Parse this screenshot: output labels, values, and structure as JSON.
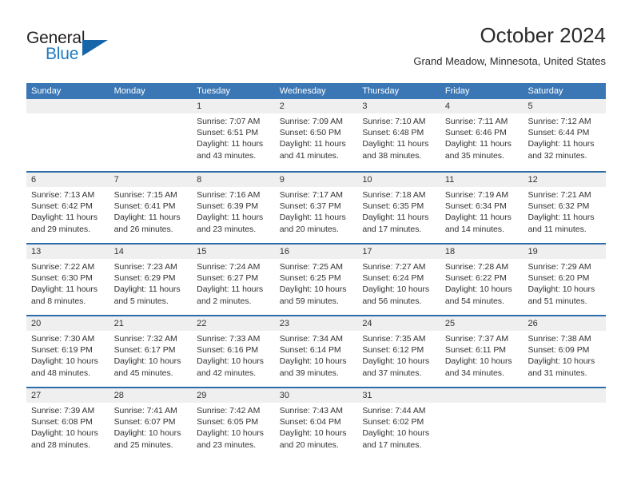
{
  "brand": {
    "name_top": "General",
    "name_bottom": "Blue",
    "triangle_icon": "triangle-icon",
    "color_top": "#231f20",
    "color_bottom": "#1f7bc1",
    "color_triangle": "#1565a8"
  },
  "header": {
    "month_title": "October 2024",
    "location": "Grand Meadow, Minnesota, United States"
  },
  "theme": {
    "header_blue": "#3b77b5",
    "row_divider_blue": "#2e6ca8",
    "date_band_gray": "#efefef",
    "text": "#333333"
  },
  "weekdays": [
    "Sunday",
    "Monday",
    "Tuesday",
    "Wednesday",
    "Thursday",
    "Friday",
    "Saturday"
  ],
  "weeks": [
    [
      {
        "day": "",
        "sunrise": "",
        "sunset": "",
        "daylight_line1": "",
        "daylight_line2": "",
        "empty": true
      },
      {
        "day": "",
        "sunrise": "",
        "sunset": "",
        "daylight_line1": "",
        "daylight_line2": "",
        "empty": true
      },
      {
        "day": "1",
        "sunrise": "Sunrise: 7:07 AM",
        "sunset": "Sunset: 6:51 PM",
        "daylight_line1": "Daylight: 11 hours",
        "daylight_line2": "and 43 minutes."
      },
      {
        "day": "2",
        "sunrise": "Sunrise: 7:09 AM",
        "sunset": "Sunset: 6:50 PM",
        "daylight_line1": "Daylight: 11 hours",
        "daylight_line2": "and 41 minutes."
      },
      {
        "day": "3",
        "sunrise": "Sunrise: 7:10 AM",
        "sunset": "Sunset: 6:48 PM",
        "daylight_line1": "Daylight: 11 hours",
        "daylight_line2": "and 38 minutes."
      },
      {
        "day": "4",
        "sunrise": "Sunrise: 7:11 AM",
        "sunset": "Sunset: 6:46 PM",
        "daylight_line1": "Daylight: 11 hours",
        "daylight_line2": "and 35 minutes."
      },
      {
        "day": "5",
        "sunrise": "Sunrise: 7:12 AM",
        "sunset": "Sunset: 6:44 PM",
        "daylight_line1": "Daylight: 11 hours",
        "daylight_line2": "and 32 minutes."
      }
    ],
    [
      {
        "day": "6",
        "sunrise": "Sunrise: 7:13 AM",
        "sunset": "Sunset: 6:42 PM",
        "daylight_line1": "Daylight: 11 hours",
        "daylight_line2": "and 29 minutes."
      },
      {
        "day": "7",
        "sunrise": "Sunrise: 7:15 AM",
        "sunset": "Sunset: 6:41 PM",
        "daylight_line1": "Daylight: 11 hours",
        "daylight_line2": "and 26 minutes."
      },
      {
        "day": "8",
        "sunrise": "Sunrise: 7:16 AM",
        "sunset": "Sunset: 6:39 PM",
        "daylight_line1": "Daylight: 11 hours",
        "daylight_line2": "and 23 minutes."
      },
      {
        "day": "9",
        "sunrise": "Sunrise: 7:17 AM",
        "sunset": "Sunset: 6:37 PM",
        "daylight_line1": "Daylight: 11 hours",
        "daylight_line2": "and 20 minutes."
      },
      {
        "day": "10",
        "sunrise": "Sunrise: 7:18 AM",
        "sunset": "Sunset: 6:35 PM",
        "daylight_line1": "Daylight: 11 hours",
        "daylight_line2": "and 17 minutes."
      },
      {
        "day": "11",
        "sunrise": "Sunrise: 7:19 AM",
        "sunset": "Sunset: 6:34 PM",
        "daylight_line1": "Daylight: 11 hours",
        "daylight_line2": "and 14 minutes."
      },
      {
        "day": "12",
        "sunrise": "Sunrise: 7:21 AM",
        "sunset": "Sunset: 6:32 PM",
        "daylight_line1": "Daylight: 11 hours",
        "daylight_line2": "and 11 minutes."
      }
    ],
    [
      {
        "day": "13",
        "sunrise": "Sunrise: 7:22 AM",
        "sunset": "Sunset: 6:30 PM",
        "daylight_line1": "Daylight: 11 hours",
        "daylight_line2": "and 8 minutes."
      },
      {
        "day": "14",
        "sunrise": "Sunrise: 7:23 AM",
        "sunset": "Sunset: 6:29 PM",
        "daylight_line1": "Daylight: 11 hours",
        "daylight_line2": "and 5 minutes."
      },
      {
        "day": "15",
        "sunrise": "Sunrise: 7:24 AM",
        "sunset": "Sunset: 6:27 PM",
        "daylight_line1": "Daylight: 11 hours",
        "daylight_line2": "and 2 minutes."
      },
      {
        "day": "16",
        "sunrise": "Sunrise: 7:25 AM",
        "sunset": "Sunset: 6:25 PM",
        "daylight_line1": "Daylight: 10 hours",
        "daylight_line2": "and 59 minutes."
      },
      {
        "day": "17",
        "sunrise": "Sunrise: 7:27 AM",
        "sunset": "Sunset: 6:24 PM",
        "daylight_line1": "Daylight: 10 hours",
        "daylight_line2": "and 56 minutes."
      },
      {
        "day": "18",
        "sunrise": "Sunrise: 7:28 AM",
        "sunset": "Sunset: 6:22 PM",
        "daylight_line1": "Daylight: 10 hours",
        "daylight_line2": "and 54 minutes."
      },
      {
        "day": "19",
        "sunrise": "Sunrise: 7:29 AM",
        "sunset": "Sunset: 6:20 PM",
        "daylight_line1": "Daylight: 10 hours",
        "daylight_line2": "and 51 minutes."
      }
    ],
    [
      {
        "day": "20",
        "sunrise": "Sunrise: 7:30 AM",
        "sunset": "Sunset: 6:19 PM",
        "daylight_line1": "Daylight: 10 hours",
        "daylight_line2": "and 48 minutes."
      },
      {
        "day": "21",
        "sunrise": "Sunrise: 7:32 AM",
        "sunset": "Sunset: 6:17 PM",
        "daylight_line1": "Daylight: 10 hours",
        "daylight_line2": "and 45 minutes."
      },
      {
        "day": "22",
        "sunrise": "Sunrise: 7:33 AM",
        "sunset": "Sunset: 6:16 PM",
        "daylight_line1": "Daylight: 10 hours",
        "daylight_line2": "and 42 minutes."
      },
      {
        "day": "23",
        "sunrise": "Sunrise: 7:34 AM",
        "sunset": "Sunset: 6:14 PM",
        "daylight_line1": "Daylight: 10 hours",
        "daylight_line2": "and 39 minutes."
      },
      {
        "day": "24",
        "sunrise": "Sunrise: 7:35 AM",
        "sunset": "Sunset: 6:12 PM",
        "daylight_line1": "Daylight: 10 hours",
        "daylight_line2": "and 37 minutes."
      },
      {
        "day": "25",
        "sunrise": "Sunrise: 7:37 AM",
        "sunset": "Sunset: 6:11 PM",
        "daylight_line1": "Daylight: 10 hours",
        "daylight_line2": "and 34 minutes."
      },
      {
        "day": "26",
        "sunrise": "Sunrise: 7:38 AM",
        "sunset": "Sunset: 6:09 PM",
        "daylight_line1": "Daylight: 10 hours",
        "daylight_line2": "and 31 minutes."
      }
    ],
    [
      {
        "day": "27",
        "sunrise": "Sunrise: 7:39 AM",
        "sunset": "Sunset: 6:08 PM",
        "daylight_line1": "Daylight: 10 hours",
        "daylight_line2": "and 28 minutes."
      },
      {
        "day": "28",
        "sunrise": "Sunrise: 7:41 AM",
        "sunset": "Sunset: 6:07 PM",
        "daylight_line1": "Daylight: 10 hours",
        "daylight_line2": "and 25 minutes."
      },
      {
        "day": "29",
        "sunrise": "Sunrise: 7:42 AM",
        "sunset": "Sunset: 6:05 PM",
        "daylight_line1": "Daylight: 10 hours",
        "daylight_line2": "and 23 minutes."
      },
      {
        "day": "30",
        "sunrise": "Sunrise: 7:43 AM",
        "sunset": "Sunset: 6:04 PM",
        "daylight_line1": "Daylight: 10 hours",
        "daylight_line2": "and 20 minutes."
      },
      {
        "day": "31",
        "sunrise": "Sunrise: 7:44 AM",
        "sunset": "Sunset: 6:02 PM",
        "daylight_line1": "Daylight: 10 hours",
        "daylight_line2": "and 17 minutes."
      },
      {
        "day": "",
        "sunrise": "",
        "sunset": "",
        "daylight_line1": "",
        "daylight_line2": "",
        "empty": true
      },
      {
        "day": "",
        "sunrise": "",
        "sunset": "",
        "daylight_line1": "",
        "daylight_line2": "",
        "empty": true
      }
    ]
  ]
}
